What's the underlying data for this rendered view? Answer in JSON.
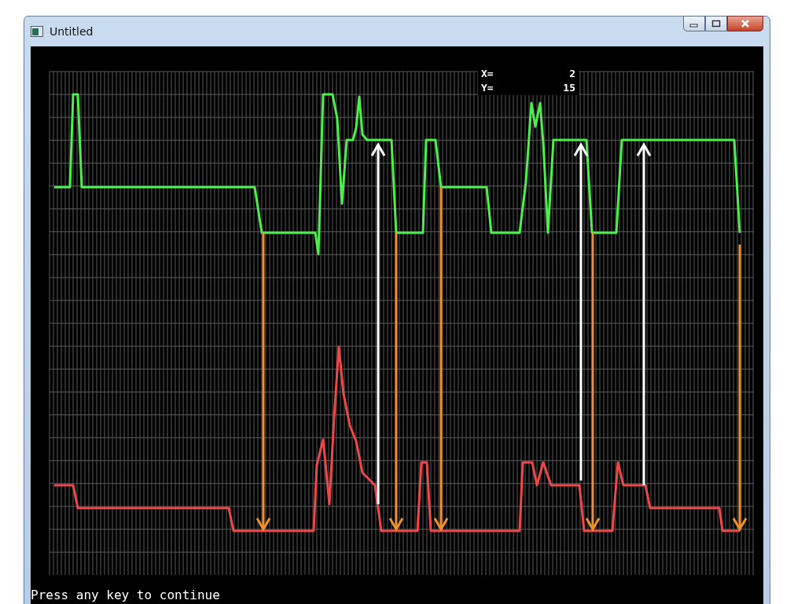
{
  "window": {
    "title": "Untitled"
  },
  "readout": [
    {
      "label": "X=",
      "value": "2"
    },
    {
      "label": "Y=",
      "value": "15"
    }
  ],
  "console": {
    "message": "Press any key to continue"
  }
}
